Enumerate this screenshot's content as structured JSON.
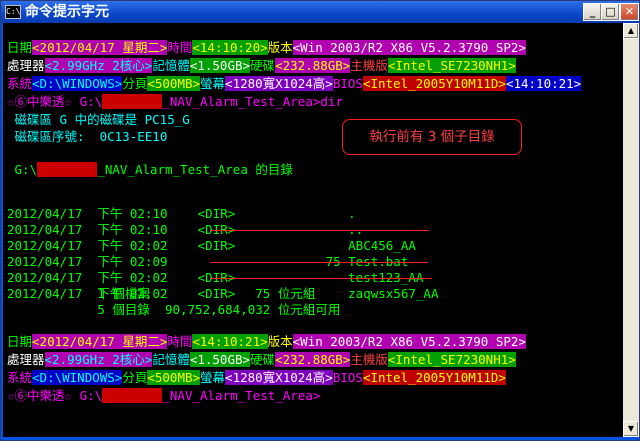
{
  "window": {
    "title": "命令提示字元",
    "icon": "C:\\",
    "min_label": "_",
    "max_label": "□",
    "close_label": "✕"
  },
  "status1": {
    "date_label": "日期",
    "date_value": "<2012/04/17 星期二>",
    "time_label": "時間",
    "time_value": "<14:10:20>",
    "ver_label": "版本",
    "ver_value": "<Win 2003/R2 X86 V5.2.3790 SP2>",
    "cpu_label": "處理器",
    "cpu_value": "<2.99GHz 2核心>",
    "mem_label": "記憶體",
    "mem_value": "<1.50GB>",
    "disk_label": "硬碟",
    "disk_value": "<232.88GB>",
    "mb_label": "主機版",
    "mb_value": "<Intel_SE7230NH1>",
    "sys_label": "系統",
    "sys_value": "<D:\\WINDOWS>",
    "page_label": "分頁",
    "page_value": "<500MB>",
    "scr_label": "螢幕",
    "scr_value": "<1280寬X1024高>",
    "bios_label": "BIOS",
    "bios_value": "<Intel_2005Y10M11D>",
    "bios_time": "<14:10:21>"
  },
  "prompt1": {
    "prefix": "☆⑥中樂透☆ G:\\",
    "redacted": "XXXXXXXX",
    "path": "_NAV_Alarm_Test_Area>dir"
  },
  "volume": {
    "line1": "磁碟區 G 中的磁碟是 PC15_G",
    "line2": "磁碟區序號:  0C13-EE10"
  },
  "dir_header": {
    "prefix": "G:\\",
    "redacted": "XXXXXXXX",
    "path": "_NAV_Alarm_Test_Area 的目錄"
  },
  "annotation": "執行前有 3 個子目錄",
  "entries": [
    {
      "date": "2012/04/17",
      "ampm": "下午",
      "time": "02:10",
      "type": "<DIR>",
      "size": "",
      "name": "."
    },
    {
      "date": "2012/04/17",
      "ampm": "下午",
      "time": "02:10",
      "type": "<DIR>",
      "size": "",
      "name": ".."
    },
    {
      "date": "2012/04/17",
      "ampm": "下午",
      "time": "02:02",
      "type": "<DIR>",
      "size": "",
      "name": "ABC456_AA"
    },
    {
      "date": "2012/04/17",
      "ampm": "下午",
      "time": "02:09",
      "type": "",
      "size": "75",
      "name": "Test.bat"
    },
    {
      "date": "2012/04/17",
      "ampm": "下午",
      "time": "02:02",
      "type": "<DIR>",
      "size": "",
      "name": "test123_AA"
    },
    {
      "date": "2012/04/17",
      "ampm": "下午",
      "time": "02:02",
      "type": "<DIR>",
      "size": "",
      "name": "zaqwsx567_AA"
    }
  ],
  "summary": {
    "files_count": "1",
    "files_label": "個檔案",
    "files_bytes": "75",
    "files_unit": "位元組",
    "dirs_count": "5",
    "dirs_label": "個目錄",
    "dirs_bytes": "90,752,684,032",
    "dirs_unit": "位元組可用"
  },
  "status2": {
    "date_value": "<2012/04/17 星期二>",
    "time_value": "<14:10:21>",
    "ver_value": "<Win 2003/R2 X86 V5.2.3790 SP2>",
    "cpu_value": "<2.99GHz 2核心>",
    "mem_value": "<1.50GB>",
    "disk_value": "<232.88GB>",
    "mb_value": "<Intel_SE7230NH1>",
    "sys_value": "<D:\\WINDOWS>",
    "page_value": "<500MB>",
    "scr_value": "<1280寬X1024高>",
    "bios_value": "<Intel_2005Y10M11D>"
  },
  "prompt2": {
    "prefix": "☆⑥中樂透☆ G:\\",
    "redacted": "XXXXXXXX",
    "path": "_NAV_Alarm_Test_Area>"
  }
}
